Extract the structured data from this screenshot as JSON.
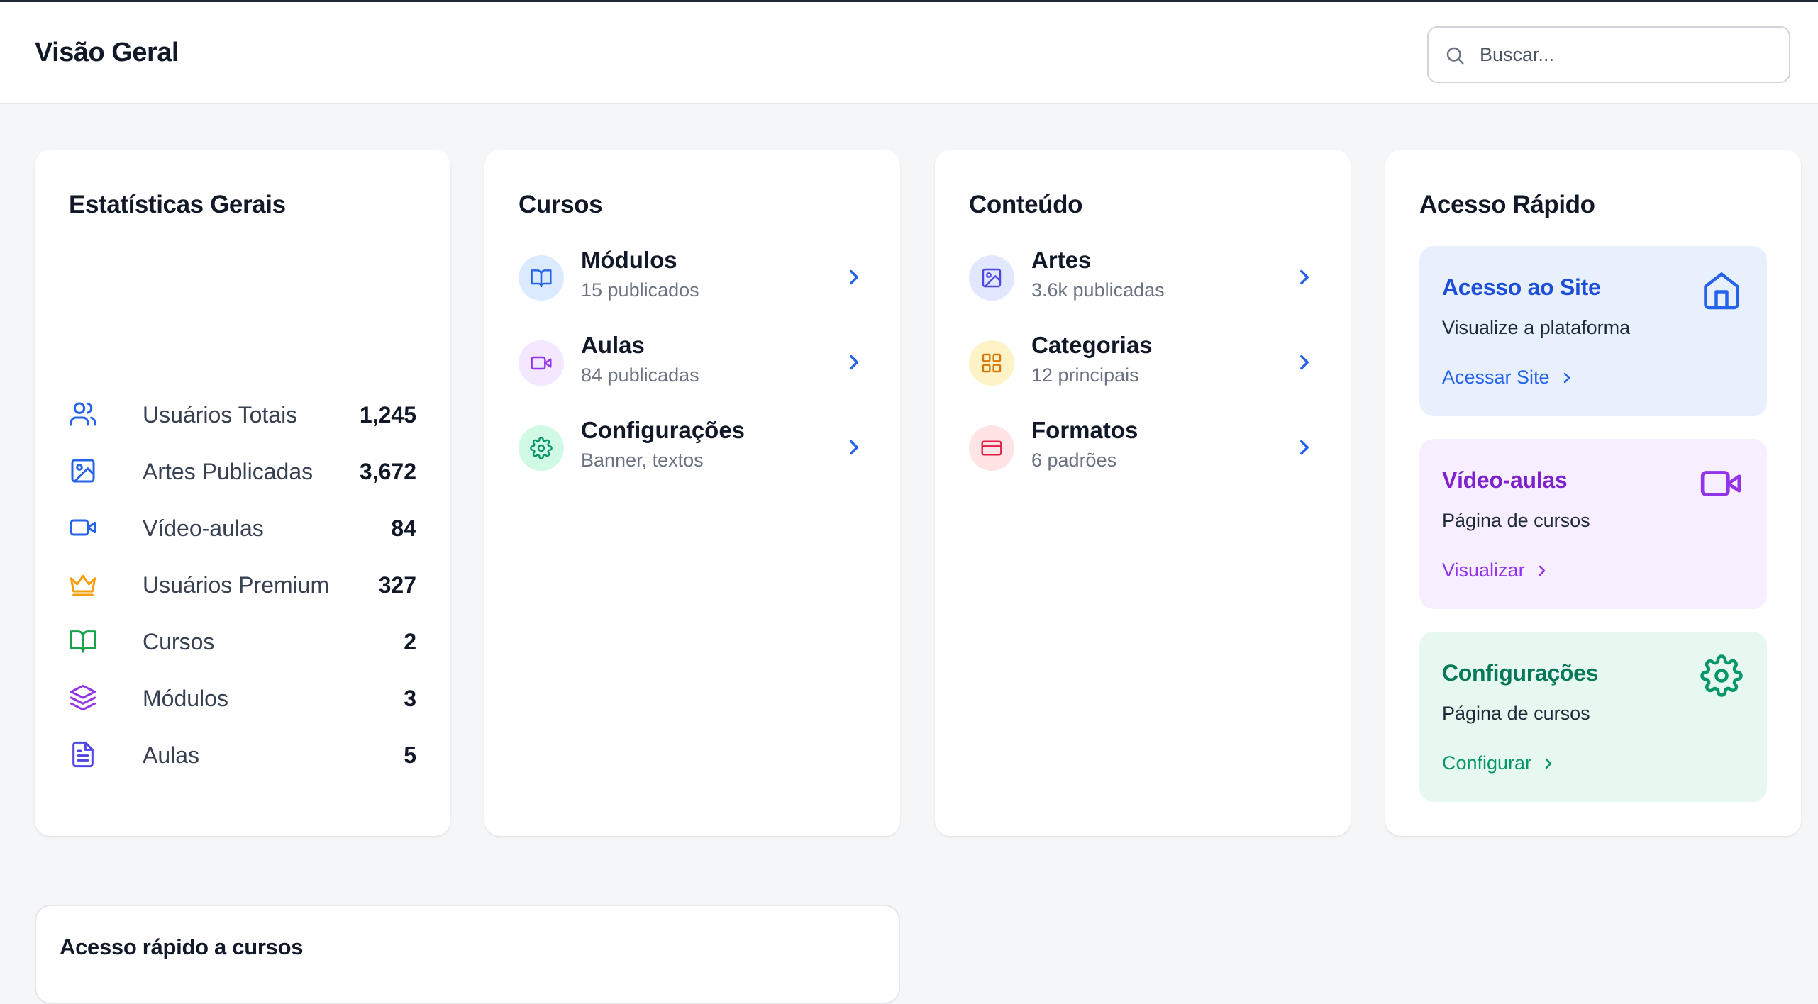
{
  "header": {
    "title": "Visão Geral",
    "search_placeholder": "Buscar..."
  },
  "stats": {
    "title": "Estatísticas Gerais",
    "items": [
      {
        "label": "Usuários Totais",
        "value": "1,245",
        "icon": "users-icon",
        "color": "#2563eb"
      },
      {
        "label": "Artes Publicadas",
        "value": "3,672",
        "icon": "image-icon",
        "color": "#2563eb"
      },
      {
        "label": "Vídeo-aulas",
        "value": "84",
        "icon": "video-icon",
        "color": "#2563eb"
      },
      {
        "label": "Usuários Premium",
        "value": "327",
        "icon": "crown-icon",
        "color": "#f59e0b"
      },
      {
        "label": "Cursos",
        "value": "2",
        "icon": "book-open-icon",
        "color": "#16a34a"
      },
      {
        "label": "Módulos",
        "value": "3",
        "icon": "layers-icon",
        "color": "#9333ea"
      },
      {
        "label": "Aulas",
        "value": "5",
        "icon": "file-text-icon",
        "color": "#4f46e5"
      }
    ]
  },
  "cursos": {
    "title": "Cursos",
    "items": [
      {
        "title": "Módulos",
        "sub": "15 publicados",
        "icon": "book-open-icon",
        "bg": "#dbeafe",
        "color": "#2563eb"
      },
      {
        "title": "Aulas",
        "sub": "84 publicadas",
        "icon": "video-icon",
        "bg": "#f3e8ff",
        "color": "#9333ea"
      },
      {
        "title": "Configurações",
        "sub": "Banner, textos",
        "icon": "gear-icon",
        "bg": "#d1fae5",
        "color": "#059669"
      }
    ]
  },
  "conteudo": {
    "title": "Conteúdo",
    "items": [
      {
        "title": "Artes",
        "sub": "3.6k publicadas",
        "icon": "image-icon",
        "bg": "#e0e7ff",
        "color": "#4f46e5"
      },
      {
        "title": "Categorias",
        "sub": "12 principais",
        "icon": "grid-icon",
        "bg": "#fef3c7",
        "color": "#d97706"
      },
      {
        "title": "Formatos",
        "sub": "6 padrões",
        "icon": "credit-card-icon",
        "bg": "#ffe4e6",
        "color": "#e11d48"
      }
    ]
  },
  "acesso": {
    "title": "Acesso Rápido",
    "items": [
      {
        "title": "Acesso ao Site",
        "desc": "Visualize a plataforma",
        "link": "Acessar Site",
        "icon": "home-icon",
        "bg": "#e8f0fe",
        "color": "#1d4ed8",
        "link_color": "#2563eb"
      },
      {
        "title": "Vídeo-aulas",
        "desc": "Página de cursos",
        "link": "Visualizar",
        "icon": "video-icon",
        "bg": "#f7efff",
        "color": "#7e22ce",
        "link_color": "#9333ea"
      },
      {
        "title": "Configurações",
        "desc": "Página de cursos",
        "link": "Configurar",
        "icon": "gear-icon",
        "bg": "#e6f8ef",
        "color": "#047857",
        "link_color": "#059669"
      }
    ]
  },
  "bottom": {
    "title": "Acesso rápido a cursos"
  }
}
